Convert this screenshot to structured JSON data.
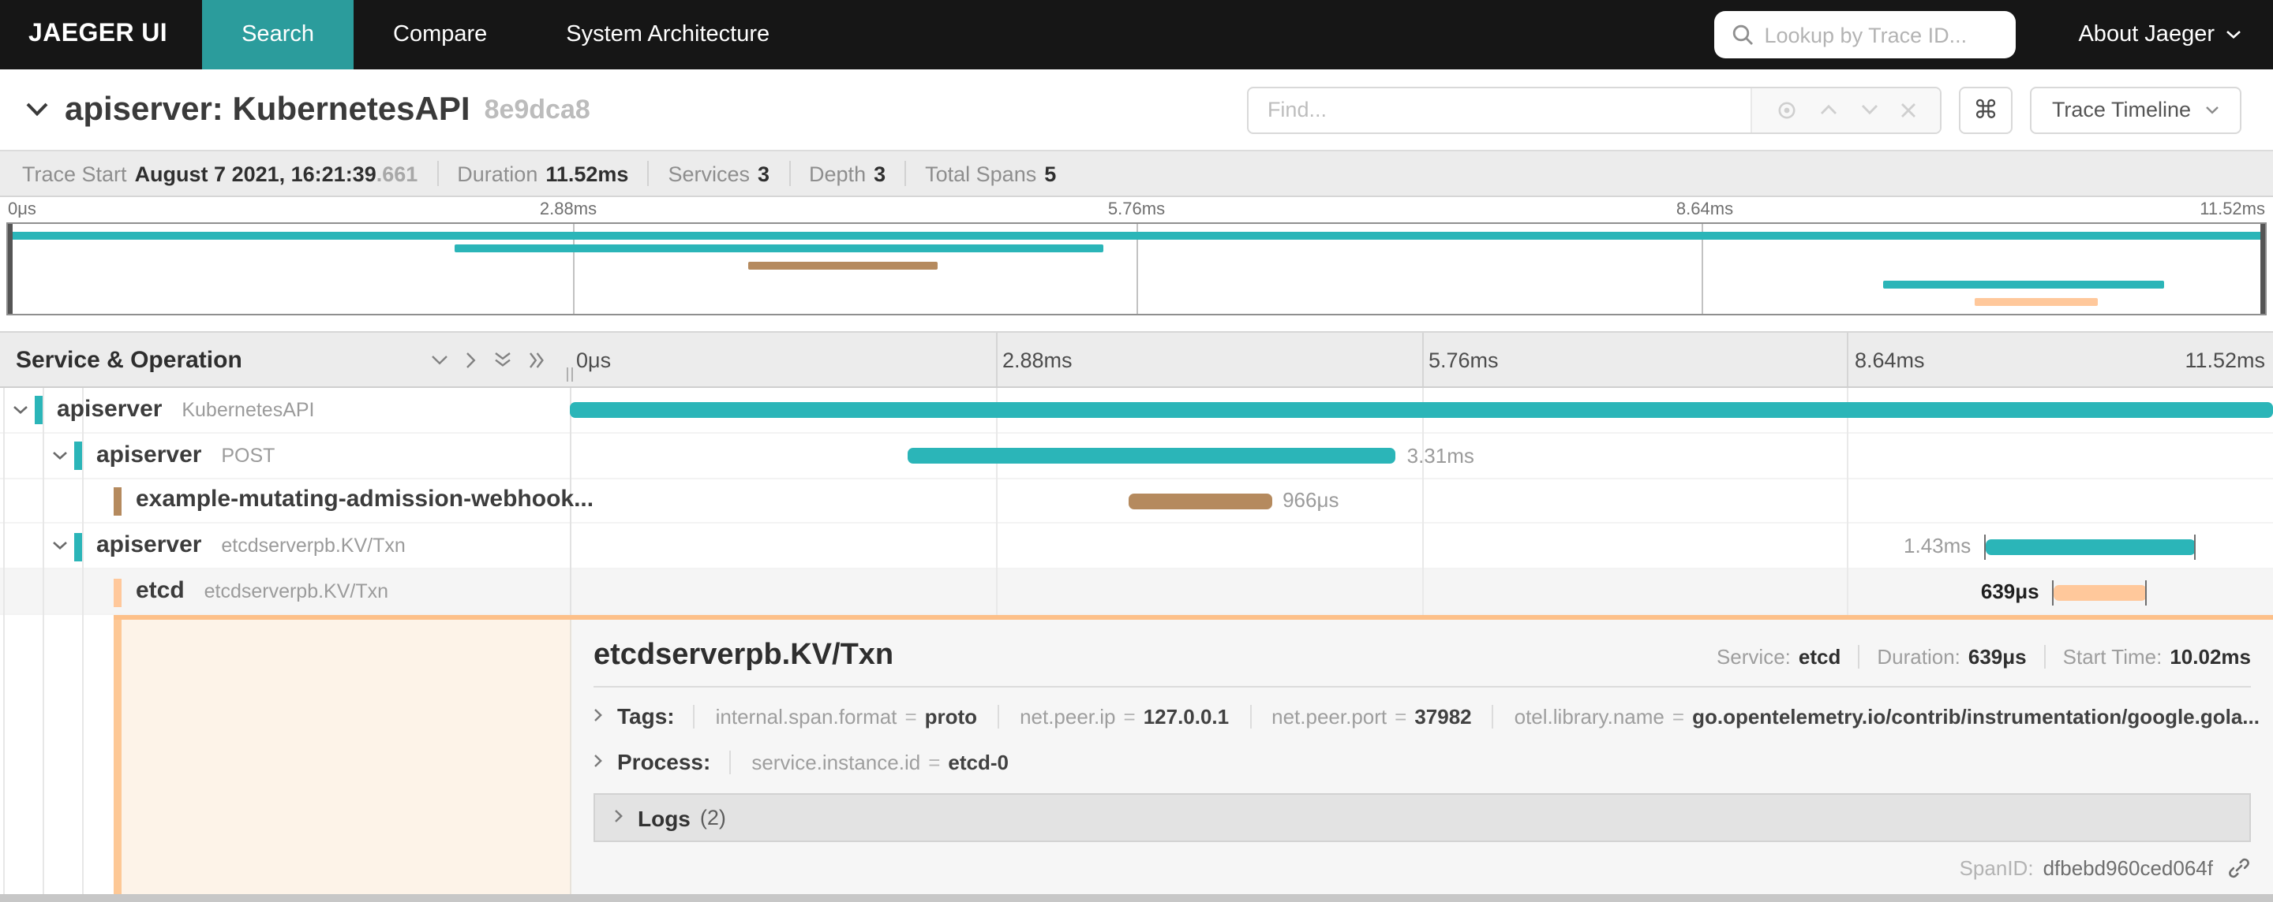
{
  "colors": {
    "teal": "#2bb5b8",
    "brown": "#b58a5e",
    "orange": "#ffc89b",
    "nav_active_bg": "#2b9c9c",
    "selected_border": "#fdc089",
    "peach_bg": "#fdf3e8"
  },
  "nav": {
    "brand": "JAEGER UI",
    "items": [
      {
        "label": "Search",
        "active": true
      },
      {
        "label": "Compare",
        "active": false
      },
      {
        "label": "System Architecture",
        "active": false
      }
    ],
    "lookup_placeholder": "Lookup by Trace ID...",
    "about_label": "About Jaeger"
  },
  "trace_header": {
    "title": "apiserver: KubernetesAPI",
    "trace_id_short": "8e9dca8",
    "find_placeholder": "Find...",
    "shortcut_glyph": "⌘",
    "view_selector_label": "Trace Timeline"
  },
  "summary": {
    "items": [
      {
        "label": "Trace Start",
        "value": "August 7 2021, 16:21:39",
        "suffix": ".661"
      },
      {
        "label": "Duration",
        "value": "11.52ms",
        "suffix": ""
      },
      {
        "label": "Services",
        "value": "3",
        "suffix": ""
      },
      {
        "label": "Depth",
        "value": "3",
        "suffix": ""
      },
      {
        "label": "Total Spans",
        "value": "5",
        "suffix": ""
      }
    ]
  },
  "minimap": {
    "ticks": [
      "0μs",
      "2.88ms",
      "5.76ms",
      "8.64ms",
      "11.52ms"
    ],
    "bars": [
      {
        "row": 0,
        "start": 0.0,
        "end": 1.0,
        "color": "teal"
      },
      {
        "row": 1,
        "start": 0.198,
        "end": 0.485,
        "color": "teal"
      },
      {
        "row": 2,
        "start": 0.328,
        "end": 0.412,
        "color": "brown"
      },
      {
        "row": 3,
        "start": 0.831,
        "end": 0.955,
        "color": "teal"
      },
      {
        "row": 4,
        "start": 0.871,
        "end": 0.926,
        "color": "orange"
      }
    ]
  },
  "grid": {
    "left_header": "Service & Operation",
    "ticks": [
      "0μs",
      "2.88ms",
      "5.76ms",
      "8.64ms",
      "11.52ms"
    ]
  },
  "spans": [
    {
      "service": "apiserver",
      "operation": "KubernetesAPI",
      "depth": 0,
      "color": "teal",
      "start": 0.0,
      "end": 1.0,
      "duration_label": "",
      "label_pos": "none",
      "selected": false
    },
    {
      "service": "apiserver",
      "operation": "POST",
      "depth": 1,
      "color": "teal",
      "start": 0.198,
      "end": 0.485,
      "duration_label": "3.31ms",
      "label_pos": "after",
      "selected": false
    },
    {
      "service": "example-mutating-admission-webhook...",
      "operation": "",
      "depth": 2,
      "color": "brown",
      "start": 0.328,
      "end": 0.412,
      "duration_label": "966μs",
      "label_pos": "after",
      "selected": false
    },
    {
      "service": "apiserver",
      "operation": "etcdserverpb.KV/Txn",
      "depth": 1,
      "color": "teal",
      "start": 0.831,
      "end": 0.955,
      "duration_label": "1.43ms",
      "label_pos": "before",
      "selected": false
    },
    {
      "service": "etcd",
      "operation": "etcdserverpb.KV/Txn",
      "depth": 2,
      "color": "orange",
      "start": 0.871,
      "end": 0.926,
      "duration_label": "639μs",
      "label_pos": "before",
      "selected": true
    }
  ],
  "detail": {
    "title": "etcdserverpb.KV/Txn",
    "meta": [
      {
        "label": "Service:",
        "value": "etcd"
      },
      {
        "label": "Duration:",
        "value": "639μs"
      },
      {
        "label": "Start Time:",
        "value": "10.02ms"
      }
    ],
    "tags_label": "Tags:",
    "tags": [
      {
        "key": "internal.span.format",
        "value": "proto"
      },
      {
        "key": "net.peer.ip",
        "value": "127.0.0.1"
      },
      {
        "key": "net.peer.port",
        "value": "37982"
      },
      {
        "key": "otel.library.name",
        "value": "go.opentelemetry.io/contrib/instrumentation/google.gola..."
      }
    ],
    "process_label": "Process:",
    "process": [
      {
        "key": "service.instance.id",
        "value": "etcd-0"
      }
    ],
    "logs_label": "Logs",
    "logs_count": "(2)",
    "span_id_label": "SpanID:",
    "span_id": "dfbebd960ced064f"
  }
}
